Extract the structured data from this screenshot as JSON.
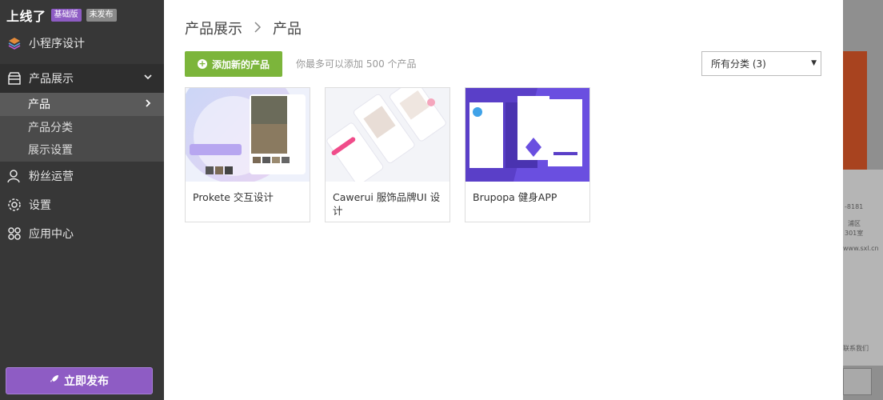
{
  "brand": {
    "name": "上线了",
    "plan_badge": "基础版",
    "status_badge": "未发布"
  },
  "sidebar": {
    "items": [
      {
        "label": "小程序设计",
        "icon": "layers-icon"
      },
      {
        "label": "产品展示",
        "icon": "store-icon"
      },
      {
        "label": "粉丝运营",
        "icon": "user-icon"
      },
      {
        "label": "设置",
        "icon": "gear-icon"
      },
      {
        "label": "应用中心",
        "icon": "apps-grid-icon"
      }
    ],
    "subitems": [
      {
        "label": "产品"
      },
      {
        "label": "产品分类"
      },
      {
        "label": "展示设置"
      }
    ],
    "publish_label": "立即发布"
  },
  "breadcrumb": {
    "parent": "产品展示",
    "current": "产品"
  },
  "toolbar": {
    "add_label": "添加新的产品",
    "hint": "你最多可以添加 500 个产品",
    "filter_value": "所有分类 (3)"
  },
  "products": [
    {
      "title": "Prokete 交互设计"
    },
    {
      "title": "Cawerui 服饰品牌UI 设计"
    },
    {
      "title": "Brupopa 健身APP"
    }
  ],
  "background_page": {
    "line1": "-8181",
    "line2": "浦区",
    "line3": "301室",
    "line4": "www.sxl.cn",
    "line5": "联系我们"
  },
  "colors": {
    "accent_purple": "#8e5cc4",
    "add_green": "#7cb53b",
    "sidebar_bg": "#373737"
  }
}
